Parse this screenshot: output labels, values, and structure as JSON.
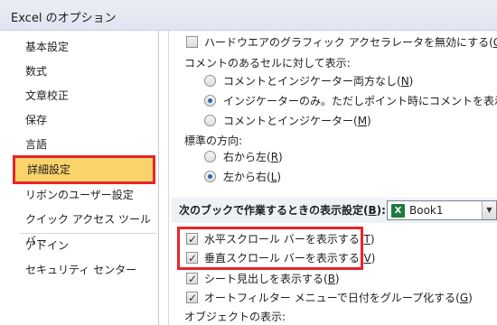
{
  "window": {
    "title": "Excel のオプション"
  },
  "sidebar": {
    "items": [
      {
        "label": "基本設定"
      },
      {
        "label": "数式"
      },
      {
        "label": "文章校正"
      },
      {
        "label": "保存"
      },
      {
        "label": "言語"
      },
      {
        "label": "詳細設定",
        "selected": true
      },
      {
        "label": "リボンのユーザー設定"
      },
      {
        "label": "クイック アクセス ツール バー"
      },
      {
        "label": "アドイン"
      },
      {
        "label": "セキュリティ センター"
      }
    ]
  },
  "main": {
    "hw_accel": {
      "label": "ハードウエアのグラフィック アクセラレータを無効にする(",
      "key": "G",
      "tail": ")",
      "checked": false
    },
    "comments_heading": "コメントのあるセルに対して表示:",
    "comment_options": [
      {
        "label": "コメントとインジケーター両方なし(",
        "key": "N",
        "tail": ")",
        "checked": false
      },
      {
        "label": "インジケーターのみ。ただしポイント時にコメントを表示(",
        "key": "I",
        "tail": ")",
        "checked": true
      },
      {
        "label": "コメントとインジケーター(",
        "key": "M",
        "tail": ")",
        "checked": false
      }
    ],
    "direction_heading": "標準の方向:",
    "direction_options": [
      {
        "label": "右から左(",
        "key": "R",
        "tail": ")",
        "checked": false
      },
      {
        "label": "左から右(",
        "key": "L",
        "tail": ")",
        "checked": true
      }
    ],
    "book_section": {
      "label": "次のブックで作業するときの表示設定(",
      "key": "B",
      "tail": "):"
    },
    "book_select": {
      "value": "Book1",
      "icon": "excel-icon"
    },
    "book_options": [
      {
        "label": "水平スクロール バーを表示する(",
        "key": "T",
        "tail": ")",
        "checked": true
      },
      {
        "label": "垂直スクロール バーを表示する(",
        "key": "V",
        "tail": ")",
        "checked": true
      },
      {
        "label": "シート見出しを表示する(",
        "key": "B",
        "tail": ")",
        "checked": true
      },
      {
        "label": "オートフィルター メニューで日付をグループ化する(",
        "key": "G",
        "tail": ")",
        "checked": true
      }
    ],
    "object_heading": "オブジェクトの表示:"
  },
  "colors": {
    "selected_bg": "#fbd36b",
    "highlight_border": "#e8242a",
    "section_band": "#eef1f5"
  }
}
